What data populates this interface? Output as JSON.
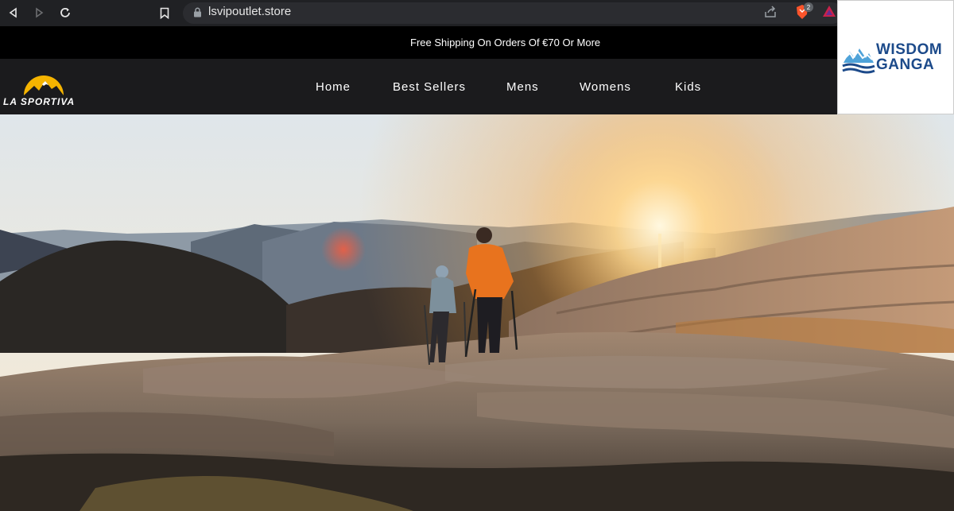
{
  "browser": {
    "url": "lsvipoutlet.store",
    "brave_badge_count": "2"
  },
  "watermark": {
    "line1": "WISDOM",
    "line2": "GANGA"
  },
  "promo": {
    "text": "Free Shipping On Orders Of €70 Or More"
  },
  "header": {
    "logo_text": "LA SPORTIVA",
    "nav": [
      {
        "label": "Home"
      },
      {
        "label": "Best Sellers"
      },
      {
        "label": "Mens"
      },
      {
        "label": "Womens"
      },
      {
        "label": "Kids"
      }
    ]
  },
  "colors": {
    "chrome_bg": "#202124",
    "promo_bg": "#000000",
    "header_bg": "#1b1b1d",
    "logo_yellow": "#f5b400",
    "hiker_orange": "#e8731e"
  }
}
